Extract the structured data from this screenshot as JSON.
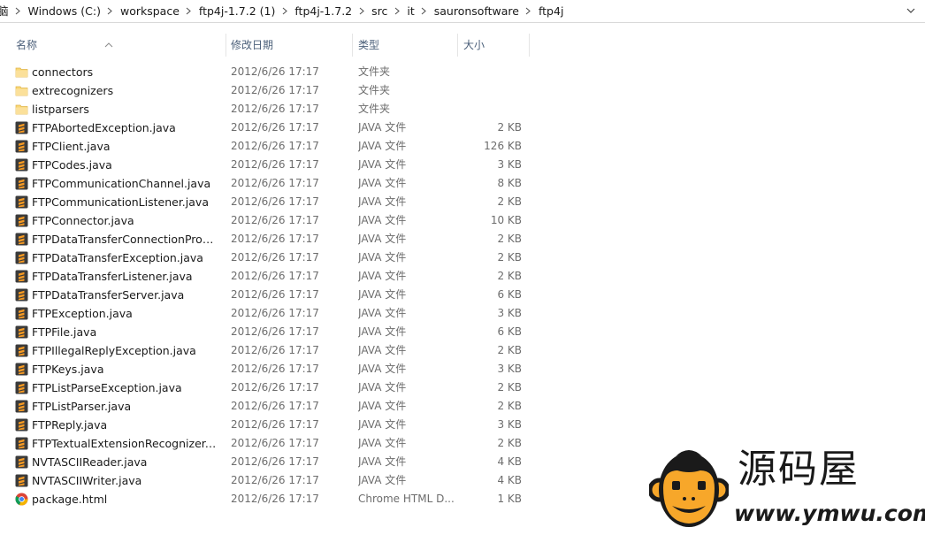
{
  "address_bar": {
    "crumbs": [
      "脑",
      "Windows (C:)",
      "workspace",
      "ftp4j-1.7.2 (1)",
      "ftp4j-1.7.2",
      "src",
      "it",
      "sauronsoftware",
      "ftp4j"
    ]
  },
  "columns": {
    "name": "名称",
    "date": "修改日期",
    "type": "类型",
    "size": "大小"
  },
  "colors": {
    "folder": "#f8d775",
    "java_icon_bg": "#3b3b3b",
    "java_icon_accent": "#f79a22",
    "header_text": "#4c607a",
    "detail_text": "#6d6d6d"
  },
  "files": [
    {
      "icon": "folder-icon",
      "name": "connectors",
      "date": "2012/6/26 17:17",
      "type": "文件夹",
      "size": ""
    },
    {
      "icon": "folder-icon",
      "name": "extrecognizers",
      "date": "2012/6/26 17:17",
      "type": "文件夹",
      "size": ""
    },
    {
      "icon": "folder-icon",
      "name": "listparsers",
      "date": "2012/6/26 17:17",
      "type": "文件夹",
      "size": ""
    },
    {
      "icon": "java-file-icon",
      "name": "FTPAbortedException.java",
      "date": "2012/6/26 17:17",
      "type": "JAVA 文件",
      "size": "2 KB"
    },
    {
      "icon": "java-file-icon",
      "name": "FTPClient.java",
      "date": "2012/6/26 17:17",
      "type": "JAVA 文件",
      "size": "126 KB"
    },
    {
      "icon": "java-file-icon",
      "name": "FTPCodes.java",
      "date": "2012/6/26 17:17",
      "type": "JAVA 文件",
      "size": "3 KB"
    },
    {
      "icon": "java-file-icon",
      "name": "FTPCommunicationChannel.java",
      "date": "2012/6/26 17:17",
      "type": "JAVA 文件",
      "size": "8 KB"
    },
    {
      "icon": "java-file-icon",
      "name": "FTPCommunicationListener.java",
      "date": "2012/6/26 17:17",
      "type": "JAVA 文件",
      "size": "2 KB"
    },
    {
      "icon": "java-file-icon",
      "name": "FTPConnector.java",
      "date": "2012/6/26 17:17",
      "type": "JAVA 文件",
      "size": "10 KB"
    },
    {
      "icon": "java-file-icon",
      "name": "FTPDataTransferConnectionProvid...",
      "date": "2012/6/26 17:17",
      "type": "JAVA 文件",
      "size": "2 KB"
    },
    {
      "icon": "java-file-icon",
      "name": "FTPDataTransferException.java",
      "date": "2012/6/26 17:17",
      "type": "JAVA 文件",
      "size": "2 KB"
    },
    {
      "icon": "java-file-icon",
      "name": "FTPDataTransferListener.java",
      "date": "2012/6/26 17:17",
      "type": "JAVA 文件",
      "size": "2 KB"
    },
    {
      "icon": "java-file-icon",
      "name": "FTPDataTransferServer.java",
      "date": "2012/6/26 17:17",
      "type": "JAVA 文件",
      "size": "6 KB"
    },
    {
      "icon": "java-file-icon",
      "name": "FTPException.java",
      "date": "2012/6/26 17:17",
      "type": "JAVA 文件",
      "size": "3 KB"
    },
    {
      "icon": "java-file-icon",
      "name": "FTPFile.java",
      "date": "2012/6/26 17:17",
      "type": "JAVA 文件",
      "size": "6 KB"
    },
    {
      "icon": "java-file-icon",
      "name": "FTPIllegalReplyException.java",
      "date": "2012/6/26 17:17",
      "type": "JAVA 文件",
      "size": "2 KB"
    },
    {
      "icon": "java-file-icon",
      "name": "FTPKeys.java",
      "date": "2012/6/26 17:17",
      "type": "JAVA 文件",
      "size": "3 KB"
    },
    {
      "icon": "java-file-icon",
      "name": "FTPListParseException.java",
      "date": "2012/6/26 17:17",
      "type": "JAVA 文件",
      "size": "2 KB"
    },
    {
      "icon": "java-file-icon",
      "name": "FTPListParser.java",
      "date": "2012/6/26 17:17",
      "type": "JAVA 文件",
      "size": "2 KB"
    },
    {
      "icon": "java-file-icon",
      "name": "FTPReply.java",
      "date": "2012/6/26 17:17",
      "type": "JAVA 文件",
      "size": "3 KB"
    },
    {
      "icon": "java-file-icon",
      "name": "FTPTextualExtensionRecognizer.java",
      "date": "2012/6/26 17:17",
      "type": "JAVA 文件",
      "size": "2 KB"
    },
    {
      "icon": "java-file-icon",
      "name": "NVTASCIIReader.java",
      "date": "2012/6/26 17:17",
      "type": "JAVA 文件",
      "size": "4 KB"
    },
    {
      "icon": "java-file-icon",
      "name": "NVTASCIIWriter.java",
      "date": "2012/6/26 17:17",
      "type": "JAVA 文件",
      "size": "4 KB"
    },
    {
      "icon": "chrome-html-icon",
      "name": "package.html",
      "date": "2012/6/26 17:17",
      "type": "Chrome HTML D...",
      "size": "1 KB"
    }
  ],
  "watermark": {
    "logo_icon": "monkey-logo-icon",
    "chinese": "源码屋",
    "url": "www.ymwu.com"
  }
}
